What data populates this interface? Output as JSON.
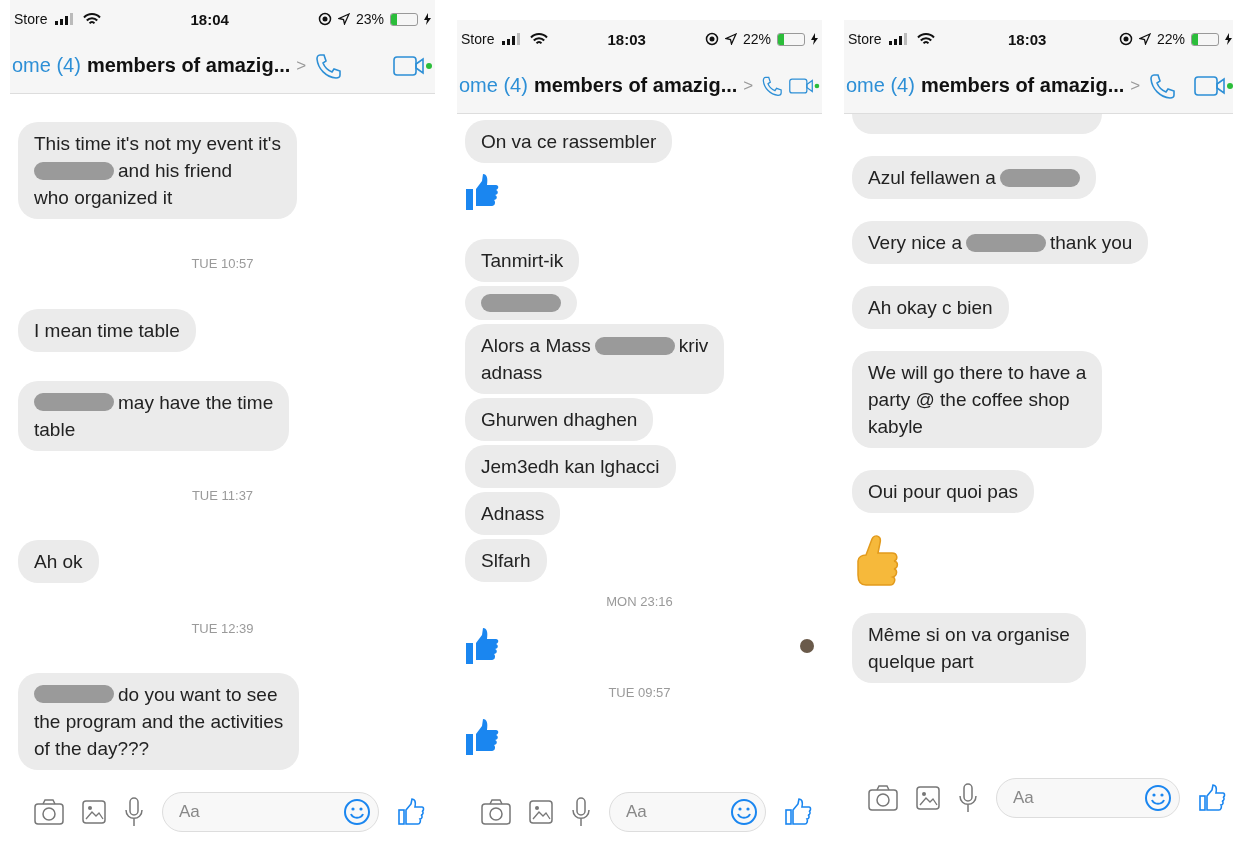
{
  "panels": [
    {
      "status_bar": {
        "carrier": "Store",
        "time": "18:04",
        "battery_text": "23%",
        "battery": {
          "level": 0.23
        }
      },
      "header": {
        "back": "ome (4)",
        "title": "members of amazig...",
        "chevron": ">"
      },
      "messages": [
        {
          "kind": "bubble",
          "lines": [
            [
              {
                "kind": "text",
                "text": "This time it's not my event it's"
              }
            ],
            [
              {
                "kind": "redacted"
              },
              {
                "kind": "text",
                "text": "and his friend"
              }
            ],
            [
              {
                "kind": "text",
                "text": "who organized it"
              }
            ]
          ]
        },
        {
          "kind": "timestamp",
          "text": "TUE 10:57"
        },
        {
          "kind": "bubble",
          "lines": [
            [
              {
                "kind": "text",
                "text": "I mean time table"
              }
            ]
          ]
        },
        {
          "kind": "bubble",
          "lines": [
            [
              {
                "kind": "redacted"
              },
              {
                "kind": "text",
                "text": "may have the time"
              }
            ],
            [
              {
                "kind": "text",
                "text": "table"
              }
            ]
          ]
        },
        {
          "kind": "timestamp",
          "text": "TUE 11:37"
        },
        {
          "kind": "bubble",
          "lines": [
            [
              {
                "kind": "text",
                "text": "Ah ok"
              }
            ]
          ]
        },
        {
          "kind": "timestamp",
          "text": "TUE 12:39"
        },
        {
          "kind": "bubble",
          "lines": [
            [
              {
                "kind": "redacted"
              },
              {
                "kind": "text",
                "text": "do you want to see"
              }
            ],
            [
              {
                "kind": "text",
                "text": "the program and the activities"
              }
            ],
            [
              {
                "kind": "text",
                "text": "of the day???"
              }
            ]
          ]
        }
      ],
      "composer": {
        "placeholder": "Aa"
      }
    },
    {
      "status_bar": {
        "carrier": "Store",
        "time": "18:03",
        "battery_text": "22%",
        "battery": {
          "level": 0.22
        }
      },
      "header": {
        "back": "ome (4)",
        "title": "members of amazig...",
        "chevron": ">"
      },
      "messages": [
        {
          "kind": "bubble",
          "lines": [
            [
              {
                "kind": "text",
                "text": "On va ce rassembler"
              }
            ]
          ]
        },
        {
          "kind": "like"
        },
        {
          "kind": "bubble",
          "lines": [
            [
              {
                "kind": "text",
                "text": "Tanmirt-ik"
              }
            ]
          ]
        },
        {
          "kind": "bubble",
          "lines": [
            [
              {
                "kind": "redacted"
              }
            ]
          ]
        },
        {
          "kind": "bubble",
          "lines": [
            [
              {
                "kind": "text",
                "text": "Alors a Mass"
              },
              {
                "kind": "redacted"
              },
              {
                "kind": "text",
                "text": "kriv"
              }
            ],
            [
              {
                "kind": "text",
                "text": "adnass"
              }
            ]
          ]
        },
        {
          "kind": "bubble",
          "lines": [
            [
              {
                "kind": "text",
                "text": "Ghurwen dhaghen"
              }
            ]
          ]
        },
        {
          "kind": "bubble",
          "lines": [
            [
              {
                "kind": "text",
                "text": "Jem3edh kan lghacci"
              }
            ]
          ]
        },
        {
          "kind": "bubble",
          "lines": [
            [
              {
                "kind": "text",
                "text": "Adnass"
              }
            ]
          ]
        },
        {
          "kind": "bubble",
          "lines": [
            [
              {
                "kind": "text",
                "text": "Slfarh"
              }
            ]
          ]
        },
        {
          "kind": "timestamp",
          "text": "MON 23:16"
        },
        {
          "kind": "like",
          "read_receipt": true
        },
        {
          "kind": "timestamp",
          "text": "TUE 09:57"
        },
        {
          "kind": "like"
        }
      ],
      "composer": {
        "placeholder": "Aa"
      }
    },
    {
      "status_bar": {
        "carrier": "Store",
        "time": "18:03",
        "battery_text": "22%",
        "battery": {
          "level": 0.22
        }
      },
      "header": {
        "back": "ome (4)",
        "title": "members of amazig...",
        "chevron": ">"
      },
      "messages": [
        {
          "kind": "cut_bubble"
        },
        {
          "kind": "bubble",
          "lines": [
            [
              {
                "kind": "text",
                "text": "Azul fellawen a"
              },
              {
                "kind": "redacted"
              }
            ]
          ]
        },
        {
          "kind": "bubble",
          "lines": [
            [
              {
                "kind": "text",
                "text": "Very nice a"
              },
              {
                "kind": "redacted"
              },
              {
                "kind": "text",
                "text": "thank you"
              }
            ]
          ]
        },
        {
          "kind": "bubble",
          "lines": [
            [
              {
                "kind": "text",
                "text": "Ah okay c bien"
              }
            ]
          ]
        },
        {
          "kind": "bubble",
          "lines": [
            [
              {
                "kind": "text",
                "text": "We will go there to have a"
              }
            ],
            [
              {
                "kind": "text",
                "text": "party @ the coffee shop"
              }
            ],
            [
              {
                "kind": "text",
                "text": "kabyle"
              }
            ]
          ]
        },
        {
          "kind": "bubble",
          "lines": [
            [
              {
                "kind": "text",
                "text": "Oui pour quoi pas"
              }
            ]
          ]
        },
        {
          "kind": "emoji"
        },
        {
          "kind": "bubble",
          "lines": [
            [
              {
                "kind": "text",
                "text": "Même si on va organise"
              }
            ],
            [
              {
                "kind": "text",
                "text": "quelque part"
              }
            ]
          ]
        }
      ],
      "composer": {
        "placeholder": "Aa"
      }
    }
  ]
}
